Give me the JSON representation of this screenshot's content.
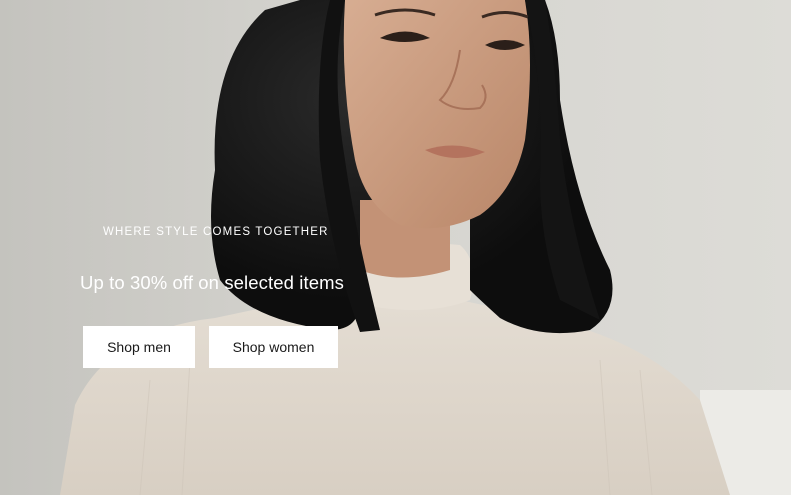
{
  "hero": {
    "eyebrow": "WHERE STYLE COMES TOGETHER",
    "headline": "Up to 30% off on selected items",
    "buttons": [
      {
        "label": "Shop men"
      },
      {
        "label": "Shop women"
      }
    ]
  }
}
